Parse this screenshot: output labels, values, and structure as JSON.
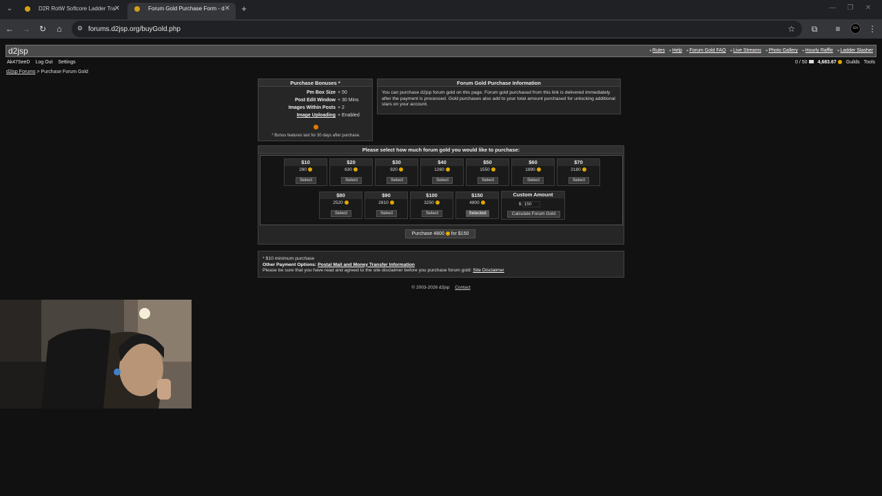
{
  "browser": {
    "tabs": [
      {
        "title": "D2R RotW Softcore Ladder Tra",
        "active": false
      },
      {
        "title": "Forum Gold Purchase Form - d",
        "active": true
      }
    ],
    "url": "forums.d2jsp.org/buyGold.php",
    "avatar_text": "d2s"
  },
  "site": {
    "logo": "d2jsp",
    "top_links": [
      "Rules",
      "Help",
      "Forum Gold FAQ",
      "Live Streams",
      "Photo Gallery",
      "Hourly Raffle",
      "Ladder Slasher"
    ],
    "user_links": [
      "Ak47SeeD",
      "Log Out",
      "Settings"
    ],
    "pm_count": "0 / 50",
    "gold": "4,683.67",
    "right_links": [
      "Guilds",
      "Tools"
    ],
    "breadcrumb": {
      "home": "d2jsp Forums",
      "sep": ">",
      "current": "Purchase Forum Gold"
    }
  },
  "bonuses": {
    "title": "Purchase Bonuses *",
    "rows": [
      {
        "key": "Pm Box Size",
        "value": "+ 50"
      },
      {
        "key": "Post Edit Window",
        "value": "+ 30 Mins"
      },
      {
        "key": "Images Within Posts",
        "value": "+ 2"
      },
      {
        "key": "Image Uploading",
        "value": "+ Enabled"
      }
    ],
    "note": "* Bonus features last for 30 days after purchase."
  },
  "info": {
    "title": "Forum Gold Purchase Information",
    "text": "You can purchase d2jsp forum gold on this page. Forum gold purchased from this link is delivered immediately after the payment is processed. Gold purchases also add to your total amount purchased for unlocking additional stars on your account."
  },
  "selection": {
    "title": "Please select how much forum gold you would like to purchase:",
    "options_row1": [
      {
        "price": "$10",
        "gold": "290",
        "button": "Select"
      },
      {
        "price": "$20",
        "gold": "630",
        "button": "Select"
      },
      {
        "price": "$30",
        "gold": "920",
        "button": "Select"
      },
      {
        "price": "$40",
        "gold": "1260",
        "button": "Select"
      },
      {
        "price": "$50",
        "gold": "1550",
        "button": "Select"
      },
      {
        "price": "$60",
        "gold": "1890",
        "button": "Select"
      },
      {
        "price": "$70",
        "gold": "2180",
        "button": "Select"
      }
    ],
    "options_row2": [
      {
        "price": "$80",
        "gold": "2520",
        "button": "Select"
      },
      {
        "price": "$90",
        "gold": "2810",
        "button": "Select"
      },
      {
        "price": "$100",
        "gold": "3250",
        "button": "Select"
      },
      {
        "price": "$150",
        "gold": "4800",
        "button": "Selected"
      }
    ],
    "custom": {
      "title": "Custom Amount",
      "currency": "$",
      "value": "150",
      "button": "Calculate Forum Gold"
    },
    "purchase": {
      "prefix": "Purchase 4800",
      "suffix": "for $150"
    }
  },
  "notes": {
    "min": "* $10 minimum purchase",
    "other_label": "Other Payment Options:",
    "other_link": "Postal Mail and Money Transfer Information",
    "disclaimer_text": "Please be sure that you have read and agreed to the site disclaimer before you purchase forum gold:",
    "disclaimer_link": "Site Disclaimer"
  },
  "footer": {
    "copyright": "© 2003-2026 d2jsp",
    "contact": "Contact"
  }
}
